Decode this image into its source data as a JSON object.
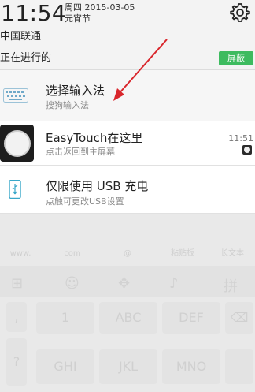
{
  "status": {
    "time": "11:54",
    "date": "周四 2015-03-05",
    "festival": "元宵节",
    "carrier": "中国联通",
    "ongoing_label": "正在进行的",
    "block_button": "屏蔽"
  },
  "notifications": [
    {
      "title": "选择输入法",
      "subtitle": "搜狗输入法",
      "icon": "keyboard-icon"
    },
    {
      "title": "EasyTouch在这里",
      "subtitle": "点击返回到主屏幕",
      "time": "11:51",
      "icon": "easytouch-icon"
    },
    {
      "title": "仅限使用 USB 充电",
      "subtitle": "点触可更改USB设置",
      "icon": "usb-icon"
    }
  ],
  "keyboard": {
    "suggestions": [
      "www.",
      "com",
      "@",
      "粘贴板",
      "长文本"
    ],
    "keys_row1": [
      "1",
      "ABC",
      "DEF"
    ],
    "keys_row2": [
      "GHI",
      "JKL",
      "MNO"
    ],
    "side_keys": [
      ",",
      "?"
    ],
    "tools": [
      "grid-icon",
      "emoji-icon",
      "cursor-icon",
      "mic-icon",
      "pinyin-icon"
    ]
  },
  "colors": {
    "accent_green": "#3dbb5f",
    "arrow_red": "#d9262c"
  }
}
